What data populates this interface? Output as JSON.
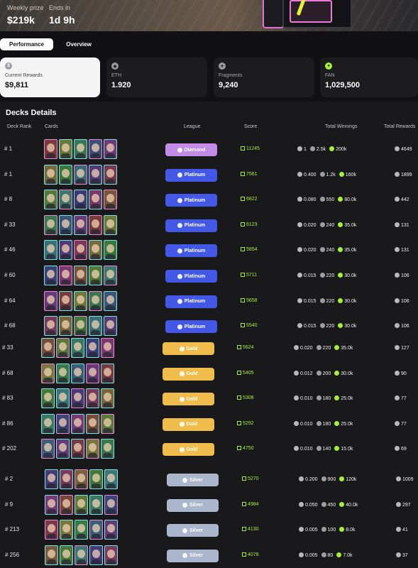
{
  "hero": {
    "weekly_prize_label": "Weekly prize",
    "weekly_prize_value": "$219k",
    "ends_in_label": "Ends in",
    "ends_in_value": "1d 9h"
  },
  "tabs": [
    {
      "label": "Performance",
      "active": true
    },
    {
      "label": "Overview",
      "active": false
    }
  ],
  "stats": [
    {
      "label": "Current Rewards",
      "value": "$9,811",
      "icon": "dollar-icon"
    },
    {
      "label": "ETH",
      "value": "1.920",
      "icon": "eth-icon"
    },
    {
      "label": "Fragments",
      "value": "9,240",
      "icon": "fragments-icon"
    },
    {
      "label": "FAN",
      "value": "1,029,500",
      "icon": "fan-icon"
    }
  ],
  "decks": {
    "title": "Decks Details",
    "columns": {
      "rank": "Deck Rank",
      "cards": "Cards",
      "league": "League",
      "score": "Score",
      "winnings": "Total Winnings",
      "rewards": "Total Rewards"
    },
    "rows": [
      {
        "rank": "# 1",
        "league": "Diamond",
        "score": "11245",
        "eth": "1",
        "frag": "2.5k",
        "fan": "200k",
        "reward": "4649"
      },
      {
        "rank": "# 1",
        "league": "Platinum",
        "score": "7561",
        "eth": "0.400",
        "frag": "1.2k",
        "fan": "160k",
        "reward": "1899"
      },
      {
        "rank": "# 8",
        "league": "Platinum",
        "score": "6822",
        "eth": "0.080",
        "frag": "550",
        "fan": "80.0k",
        "reward": "442"
      },
      {
        "rank": "# 33",
        "league": "Platinum",
        "score": "6123",
        "eth": "0.020",
        "frag": "240",
        "fan": "35.0k",
        "reward": "131"
      },
      {
        "rank": "# 46",
        "league": "Platinum",
        "score": "5854",
        "eth": "0.020",
        "frag": "240",
        "fan": "35.0k",
        "reward": "131"
      },
      {
        "rank": "# 60",
        "league": "Platinum",
        "score": "5711",
        "eth": "0.015",
        "frag": "220",
        "fan": "30.0k",
        "reward": "106"
      },
      {
        "rank": "# 64",
        "league": "Platinum",
        "score": "5658",
        "eth": "0.015",
        "frag": "220",
        "fan": "30.0k",
        "reward": "106"
      },
      {
        "rank": "# 68",
        "league": "Platinum",
        "score": "5540",
        "eth": "0.015",
        "frag": "220",
        "fan": "30.0k",
        "reward": "106"
      },
      {
        "rank": "# 33",
        "league": "Gold",
        "score": "5624",
        "eth": "0.020",
        "frag": "220",
        "fan": "35.0k",
        "reward": "127"
      },
      {
        "rank": "# 68",
        "league": "Gold",
        "score": "5405",
        "eth": "0.012",
        "frag": "200",
        "fan": "30.0k",
        "reward": "90"
      },
      {
        "rank": "# 83",
        "league": "Gold",
        "score": "5308",
        "eth": "0.010",
        "frag": "180",
        "fan": "25.0k",
        "reward": "77"
      },
      {
        "rank": "# 86",
        "league": "Gold",
        "score": "5292",
        "eth": "0.010",
        "frag": "180",
        "fan": "25.0k",
        "reward": "77"
      },
      {
        "rank": "# 202",
        "league": "Gold",
        "score": "4750",
        "eth": "0.010",
        "frag": "140",
        "fan": "15.0k",
        "reward": "69"
      },
      {
        "rank": "# 2",
        "league": "Silver",
        "score": "5270",
        "eth": "0.200",
        "frag": "900",
        "fan": "120k",
        "reward": "1009"
      },
      {
        "rank": "# 9",
        "league": "Silver",
        "score": "4984",
        "eth": "0.050",
        "frag": "450",
        "fan": "40.0k",
        "reward": "297"
      },
      {
        "rank": "# 213",
        "league": "Silver",
        "score": "4130",
        "eth": "0.005",
        "frag": "100",
        "fan": "8.0k",
        "reward": "41"
      },
      {
        "rank": "# 256",
        "league": "Silver",
        "score": "4078",
        "eth": "0.005",
        "frag": "80",
        "fan": "7.0k",
        "reward": "37"
      }
    ]
  }
}
